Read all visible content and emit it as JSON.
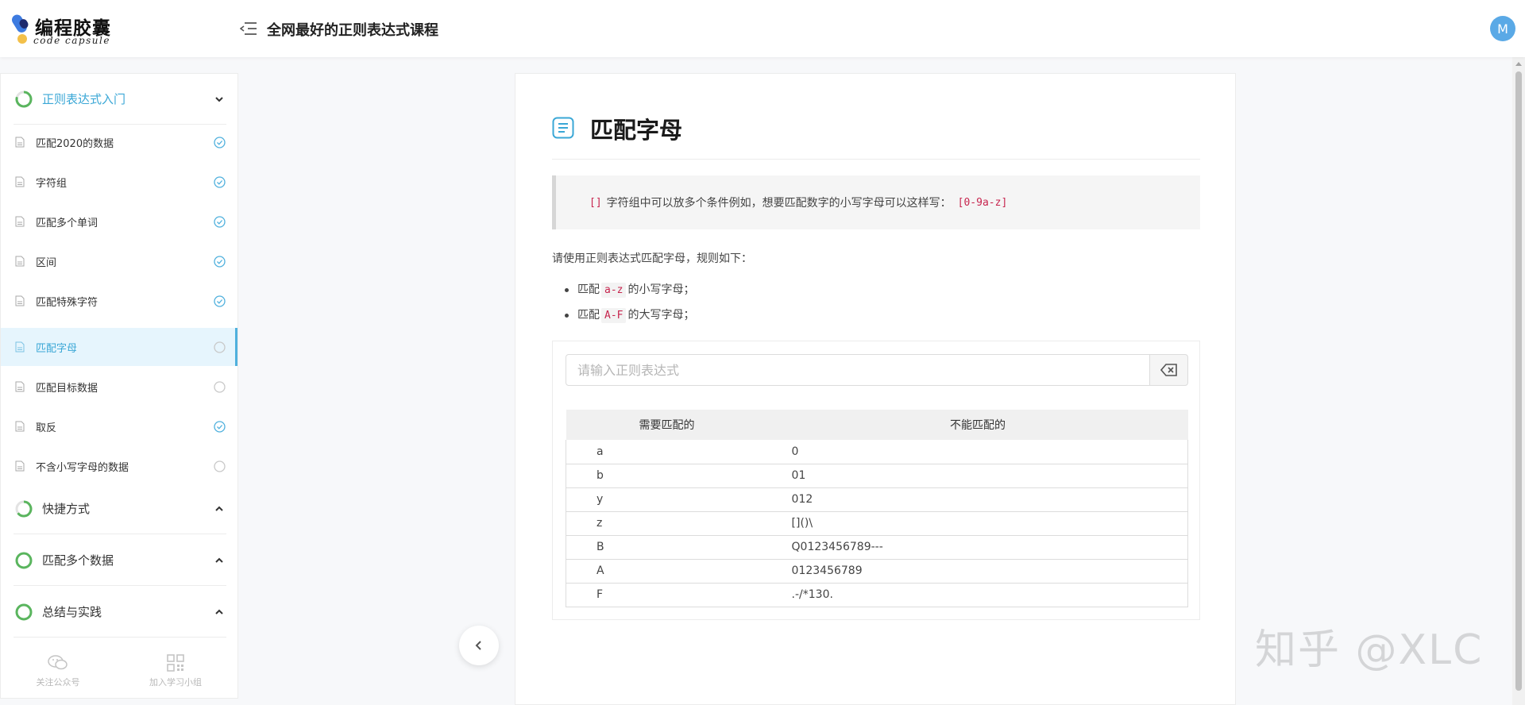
{
  "app": {
    "logo_cn": "编程胶囊",
    "logo_en": "code capsule",
    "course_title": "全网最好的正则表达式课程",
    "avatar_letter": "M",
    "accent_color": "#3aa7d6",
    "done_color": "#5ab55e"
  },
  "sidebar": {
    "chapters": [
      {
        "label": "正则表达式入门",
        "expanded": true,
        "active": true,
        "progress": 0.9,
        "icon": "progress-ring-icon"
      },
      {
        "label": "快捷方式",
        "expanded": false,
        "progress": 0.6,
        "icon": "progress-ring-icon"
      },
      {
        "label": "匹配多个数据",
        "expanded": false,
        "progress": 1.0,
        "icon": "progress-ring-icon"
      },
      {
        "label": "总结与实践",
        "expanded": false,
        "progress": 1.0,
        "icon": "progress-ring-icon"
      }
    ],
    "lessons": [
      {
        "label": "匹配2020的数据",
        "status": "done"
      },
      {
        "label": "字符组",
        "status": "done"
      },
      {
        "label": "匹配多个单词",
        "status": "done"
      },
      {
        "label": "区间",
        "status": "done"
      },
      {
        "label": "匹配特殊字符",
        "status": "done"
      },
      {
        "label": "匹配字母",
        "status": "current"
      },
      {
        "label": "匹配目标数据",
        "status": "todo"
      },
      {
        "label": "取反",
        "status": "done"
      },
      {
        "label": "不含小写字母的数据",
        "status": "todo"
      }
    ],
    "footer": {
      "wechat_label": "关注公众号",
      "group_label": "加入学习小组"
    }
  },
  "lesson": {
    "title": "匹配字母",
    "tip": {
      "code1": "[]",
      "text": "字符组中可以放多个条件例如，想要匹配数字的小写字母可以这样写：",
      "code2": "[0-9a-z]"
    },
    "intro": "请使用正则表达式匹配字母，规则如下：",
    "rules": [
      {
        "prefix": "匹配",
        "code": "a-z",
        "suffix": "的小写字母；"
      },
      {
        "prefix": "匹配",
        "code": "A-F",
        "suffix": "的大写字母；"
      }
    ],
    "input": {
      "placeholder": "请输入正则表达式",
      "value": ""
    },
    "table": {
      "headers": [
        "需要匹配的",
        "不能匹配的"
      ],
      "rows": [
        [
          "a",
          "0"
        ],
        [
          "b",
          "01"
        ],
        [
          "y",
          "012"
        ],
        [
          "z",
          "[]()\\"
        ],
        [
          "B",
          "Q0123456789---"
        ],
        [
          "A",
          "0123456789"
        ],
        [
          "F",
          ".-/*130."
        ]
      ]
    }
  },
  "watermark": "知乎 @XLC"
}
